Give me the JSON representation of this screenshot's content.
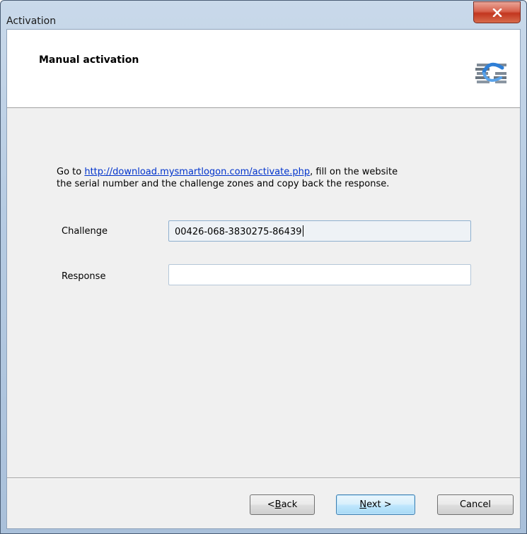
{
  "window": {
    "title": "Activation",
    "close_glyph": "x"
  },
  "header": {
    "title": "Manual activation",
    "logo_icon": "product-logo-icon"
  },
  "instructions": {
    "prefix": "Go to ",
    "link": "http://download.mysmartlogon.com/activate.php",
    "line1_rest": ", fill on the website",
    "line2": "the serial number and the challenge zones and copy back the response."
  },
  "form": {
    "challenge_label": "Challenge",
    "challenge_value": "00426-068-3830275-86439",
    "response_label": "Response",
    "response_value": ""
  },
  "buttons": {
    "back_pre": "< ",
    "back_ul": "B",
    "back_post": "ack",
    "next_ul": "N",
    "next_post": "ext >",
    "cancel": "Cancel"
  },
  "colors": {
    "link": "#0033cc",
    "close_button": "#c2361f",
    "default_button_border": "#3c7fb1"
  }
}
